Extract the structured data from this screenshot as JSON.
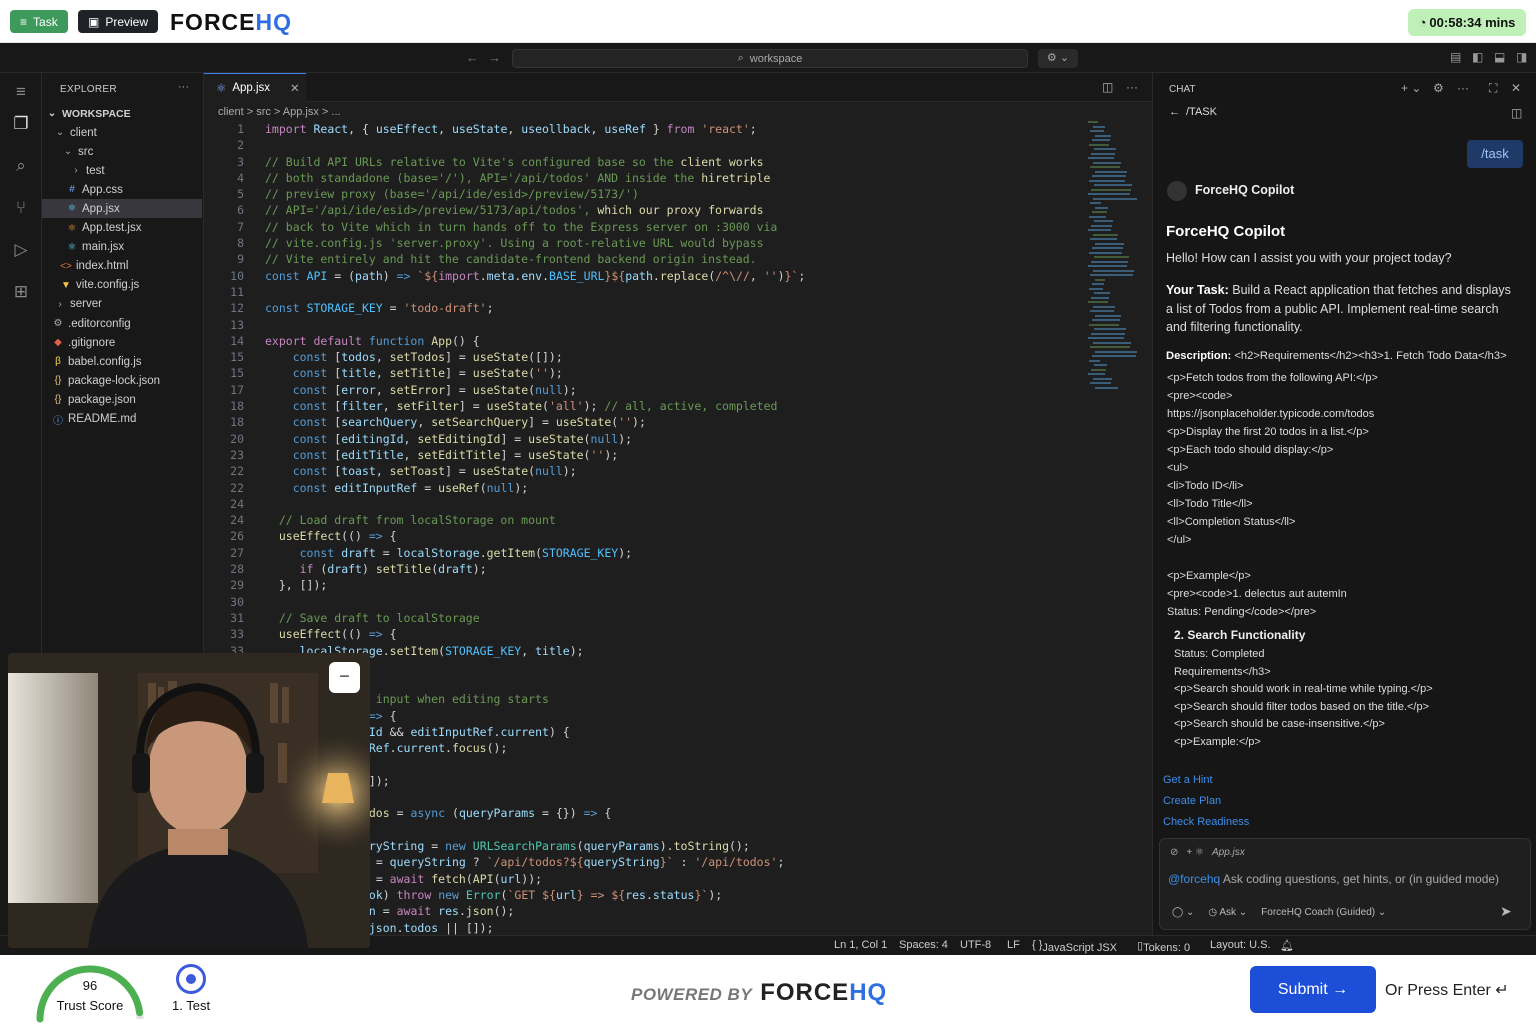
{
  "topbar": {
    "task_label": "Task",
    "preview_label": "Preview",
    "logo_left": "FORCE",
    "logo_right": "HQ",
    "timer": "00:58:34 mins"
  },
  "ide": {
    "search_placeholder": "workspace",
    "explorer_title": "EXPLORER",
    "workspace_label": "WORKSPACE",
    "tree": [
      {
        "label": "client",
        "icon": "chevron-down"
      },
      {
        "label": "src",
        "icon": "chevron-down"
      },
      {
        "label": "test",
        "icon": "chevron-right"
      },
      {
        "label": "App.css",
        "icon": "hash"
      },
      {
        "label": "App.jsx",
        "icon": "react"
      },
      {
        "label": "App.test.jsx",
        "icon": "react-test"
      },
      {
        "label": "main.jsx",
        "icon": "react"
      },
      {
        "label": "index.html",
        "icon": "html"
      },
      {
        "label": "vite.config.js",
        "icon": "vite"
      },
      {
        "label": "server",
        "icon": "chevron-right"
      },
      {
        "label": ".editorconfig",
        "icon": "gear"
      },
      {
        "label": ".gitignore",
        "icon": "git"
      },
      {
        "label": "babel.config.js",
        "icon": "babel"
      },
      {
        "label": "package-lock.json",
        "icon": "braces"
      },
      {
        "label": "package.json",
        "icon": "braces"
      },
      {
        "label": "README.md",
        "icon": "info"
      }
    ],
    "tab_label": "App.jsx",
    "breadcrumb": "client > src > App.jsx > ...",
    "line_numbers": [
      "1",
      "2",
      "3",
      "4",
      "5",
      "6",
      "7",
      "8",
      "9",
      "10",
      "11",
      "12",
      "13",
      "14",
      "15",
      "15",
      "17",
      "18",
      "18",
      "20",
      "23",
      "22",
      "22",
      "24",
      "24",
      "26",
      "27",
      "28",
      "29",
      "30",
      "31",
      "33",
      "33"
    ],
    "status": {
      "position": "Ln 1, Col 1",
      "spaces": "Spaces: 4",
      "encoding": "UTF-8",
      "eol": "LF",
      "language": "JavaScript JSX",
      "tokens": "Tokens: 0",
      "layout": "Layout: U.S."
    }
  },
  "chat": {
    "header": "CHAT",
    "back_label": "/TASK",
    "user_bubble": "/task",
    "bot_name": "ForceHQ Copilot",
    "title": "ForceHQ Copilot",
    "greeting": "Hello! How can I assist you with your project today?",
    "task_label": "Your Task:",
    "task_text": "Build a React application that fetches and displays a list of Todos from a public API. Implement real-time search and filtering functionality.",
    "desc_label": "Description:",
    "desc_first": "<h2>Requirements</h2><h3>1. Fetch Todo Data</h3>",
    "desc_lines": [
      "<p>Fetch todos from the following API:</p>",
      "<pre><code>",
      "https://jsonplaceholder.typicode.com/todos",
      "<p>Display the first 20 todos in a list.</p>",
      "<p>Each todo should display:</p>",
      "<ul>",
      "<li>Todo ID</li>",
      "<ll>Todo Title</ll>",
      "<ll>Completion Status</ll>",
      "</ul>",
      "",
      "<p>Example</p>",
      "<pre><code>1. delectus aut autemIn",
      "Status: Pending</code></pre>"
    ],
    "section2_title": "2. Search Functionality",
    "section2_lines": [
      "Status: Completed",
      "Requirements</h3>",
      "<p>Search should work in real-time while typing.</p>",
      "<p>Search should filter todos based on the title.</p>",
      "<p>Search should be case-insensitive.</p>",
      "<p>Example:</p>"
    ],
    "links": [
      "Get a Hint",
      "Create Plan",
      "Check Readiness"
    ],
    "context_file": "App.jsx",
    "mention": "@forcehq",
    "input_placeholder": "Ask coding questions, get hints, or (in guided mode)",
    "mode": "Ask",
    "coach": "ForceHQ Coach (Guided)"
  },
  "footer": {
    "score": "96",
    "score_fraction": 0.96,
    "score_label": "Trust Score",
    "step_label": "1. Test",
    "powered_by": "POWERED BY",
    "logo_left": "FORCE",
    "logo_right": "HQ",
    "submit_label": "Submit →",
    "press_enter": "Or Press Enter ↵"
  },
  "colors": {
    "accent": "#1d4ed8",
    "task_green": "#3e9a5a",
    "timer_bg": "#bff0b8",
    "gauge": "#4caf50",
    "link": "#3b8eea"
  }
}
